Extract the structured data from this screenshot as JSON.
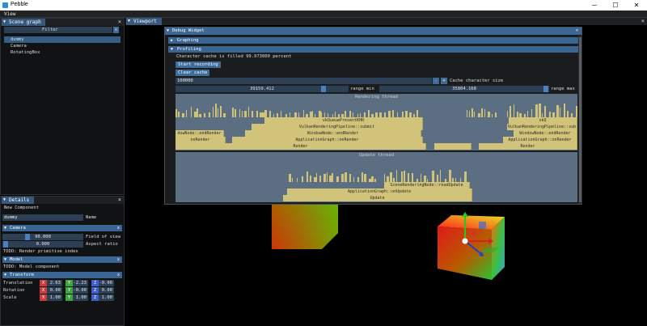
{
  "app": {
    "title": "Pebble",
    "menu": "View",
    "win_min": "─",
    "win_max": "☐",
    "win_close": "✕"
  },
  "scene_graph": {
    "tab": "Scene graph",
    "close": "×",
    "filter_label": "Filter",
    "filter_clear": "x",
    "items": [
      "dummy",
      "Camera",
      "RotatingBox"
    ]
  },
  "viewport": {
    "tab": "Viewport",
    "close": "×"
  },
  "details": {
    "tab": "Details",
    "close": "×",
    "new_component": "New Component",
    "name_value": "dummy",
    "name_label": "Name",
    "camera": {
      "header": "Camera",
      "fov_value": "90.000",
      "fov_level": 0.3,
      "fov_label": "Field of view",
      "aspect_value": "0.000",
      "aspect_label": "Aspect ratio",
      "todo": "TODO: Render primitive index"
    },
    "model": {
      "header": "Model",
      "todo": "TODO: Model component"
    },
    "transform": {
      "header": "Transform",
      "rows": [
        {
          "label": "Translation",
          "x": "2.63",
          "y": "-2.23",
          "z": "-0.00"
        },
        {
          "label": "Rotation",
          "x": "0.00",
          "y": "-0.00",
          "z": "0.00"
        },
        {
          "label": "Scale",
          "x": "1.00",
          "y": "1.00",
          "z": "1.00"
        }
      ],
      "axis_x": "X",
      "axis_y": "Y",
      "axis_z": "Z",
      "colors": {
        "x": "#c83c3c",
        "y": "#3ca83c",
        "z": "#3c5fc8"
      }
    },
    "header_close": "x"
  },
  "debug": {
    "title": "Debug Widget",
    "close": "×",
    "graphing": "Graphing",
    "profiling": "Profiling",
    "cache_text": "Character cache is filled 99.973000 percent",
    "start_recording": "Start recording",
    "clear_cache": "Clear cache",
    "cache_size_value": "100000",
    "cache_size_minus": "-",
    "cache_size_plus": "+",
    "cache_size_label": "Cache character size",
    "range_min_value": "39159.412",
    "range_min_label": "range min",
    "range_max_value": "35804.168",
    "range_max_label": "range max",
    "rendering_thread": "Rendering thread",
    "update_thread": "Update thread",
    "render_bars": {
      "render": "Render",
      "ag_onrender": "ApplicationGraph::onRender",
      "onrender": "onRender",
      "wn_endrender": "WindowNode::endRender",
      "wn_endrender_short": "WindowNode::endRender",
      "wn_endrender_trunc": "dowNode::endRender",
      "vrp_submit": "VulkanRenderingPipeline::submit",
      "vrp_short": "VulkanRenderingPipeline::sub",
      "vk_present": "vkQueuePresentKHR",
      "vk_trunc": "vkQ"
    },
    "update_bars": {
      "update": "Update",
      "ag_onupdate": "ApplicationGraph::onUpdate",
      "srn_readupdate": "SceneRenderingNode::readUpdate"
    },
    "flame_color": "#d1c47a"
  }
}
